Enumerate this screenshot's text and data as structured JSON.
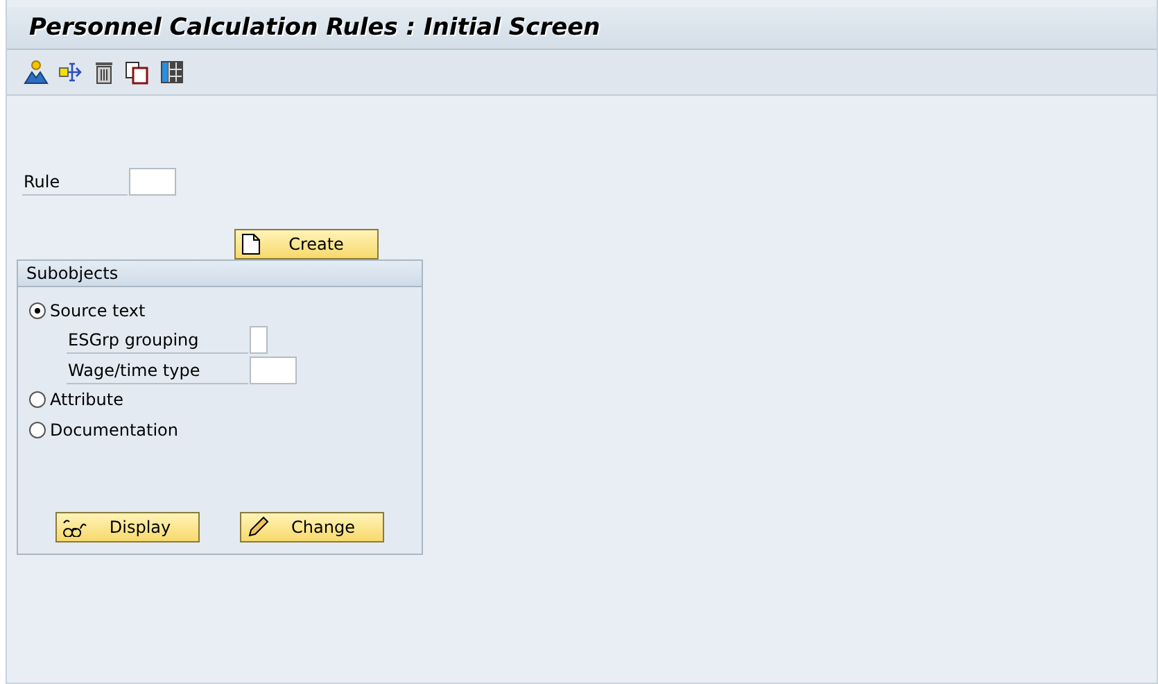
{
  "window": {
    "title": "Personnel Calculation Rules : Initial Screen"
  },
  "toolbar": [
    {
      "kind": "person"
    },
    {
      "kind": "transfer"
    },
    {
      "kind": "trash"
    },
    {
      "kind": "copy"
    },
    {
      "kind": "grid"
    }
  ],
  "rule": {
    "label": "Rule"
  },
  "create_button": {
    "label": "Create",
    "kind": "page"
  },
  "subobjects": {
    "title": "Subobjects",
    "options": [
      {
        "label": "Source text",
        "selected": true,
        "fields": [
          {
            "label": "ESGrp grouping",
            "kind": "narrow"
          },
          {
            "label": "Wage/time type",
            "kind": "wide"
          }
        ]
      },
      {
        "label": "Attribute",
        "selected": false
      },
      {
        "label": "Documentation",
        "selected": false
      }
    ],
    "buttons": [
      {
        "label": "Display",
        "kind": "glasses"
      },
      {
        "label": "Change",
        "kind": "pencil"
      }
    ]
  }
}
